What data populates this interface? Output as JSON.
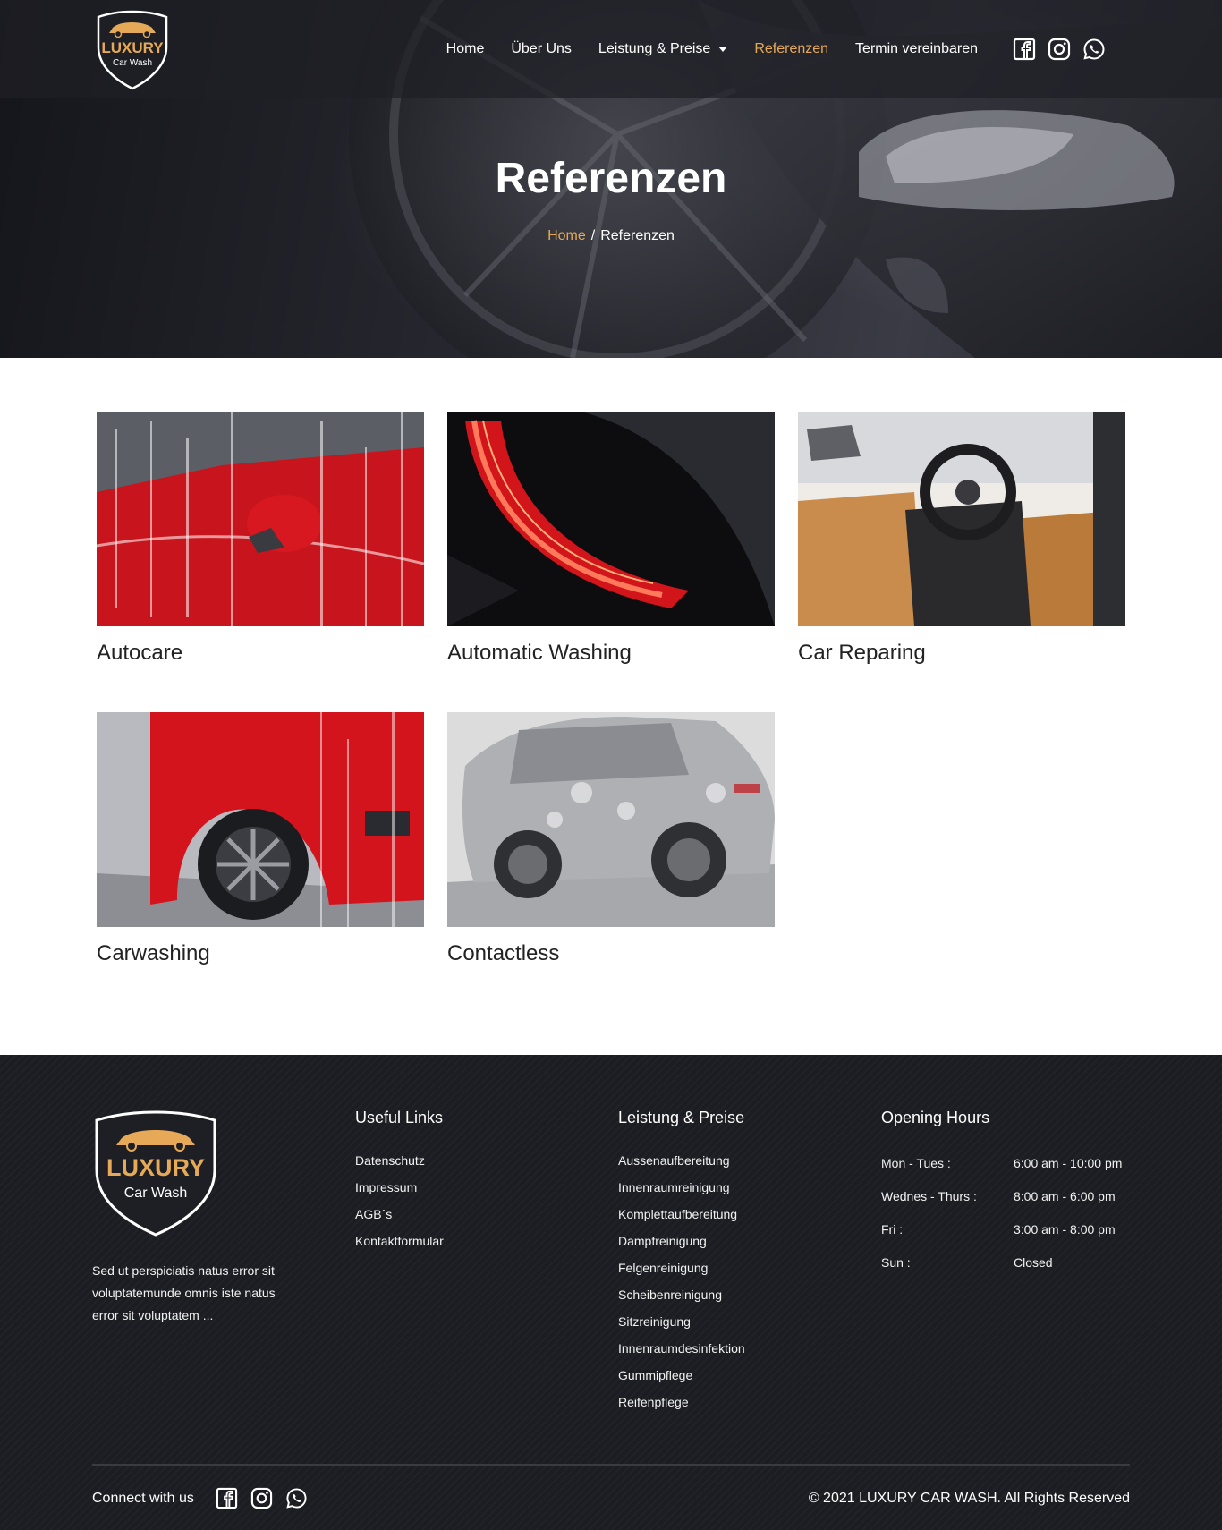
{
  "brand": {
    "name": "LUXURY",
    "sub": "Car Wash"
  },
  "nav": {
    "items": [
      {
        "label": "Home"
      },
      {
        "label": "Über Uns"
      },
      {
        "label": "Leistung & Preise"
      },
      {
        "label": "Referenzen"
      },
      {
        "label": "Termin vereinbaren"
      }
    ],
    "active": "Referenzen"
  },
  "hero": {
    "title": "Referenzen",
    "breadcrumb": {
      "home": "Home",
      "separator": "/",
      "current": "Referenzen"
    }
  },
  "gallery": [
    {
      "title": "Autocare",
      "image": "red-car-mirror-foam"
    },
    {
      "title": "Automatic Washing",
      "image": "red-tail-light"
    },
    {
      "title": "Car Reparing",
      "image": "tan-leather-interior"
    },
    {
      "title": "Carwashing",
      "image": "red-car-wheel-spray"
    },
    {
      "title": "Contactless",
      "image": "foamed-suv"
    }
  ],
  "footer": {
    "description": "Sed ut perspiciatis natus error sit voluptatemunde omnis iste natus error sit voluptatem ...",
    "useful_links": {
      "heading": "Useful Links",
      "items": [
        "Datenschutz",
        "Impressum",
        "AGB´s",
        "Kontaktformular"
      ]
    },
    "services": {
      "heading": "Leistung & Preise",
      "items": [
        "Aussenaufbereitung",
        "Innenraumreinigung",
        "Komplettaufbereitung",
        "Dampfreinigung",
        "Felgenreinigung",
        "Scheibenreinigung",
        "Sitzreinigung",
        "Innenraumdesinfektion",
        "Gummipflege",
        "Reifenpflege"
      ]
    },
    "hours": {
      "heading": "Opening Hours",
      "rows": [
        {
          "day": "Mon - Tues :",
          "time": "6:00 am - 10:00 pm"
        },
        {
          "day": "Wednes - Thurs :",
          "time": "8:00 am - 6:00 pm"
        },
        {
          "day": "Fri :",
          "time": "3:00 am - 8:00 pm"
        },
        {
          "day": "Sun :",
          "time": "Closed"
        }
      ]
    },
    "connect_label": "Connect with us",
    "copyright": "© 2021 LUXURY CAR WASH. All Rights Reserved"
  },
  "colors": {
    "accent": "#e6a957",
    "dark": "#1c1d22",
    "text": "#222222"
  },
  "icons": [
    "facebook-icon",
    "instagram-icon",
    "whatsapp-icon",
    "chevron-down-icon"
  ]
}
